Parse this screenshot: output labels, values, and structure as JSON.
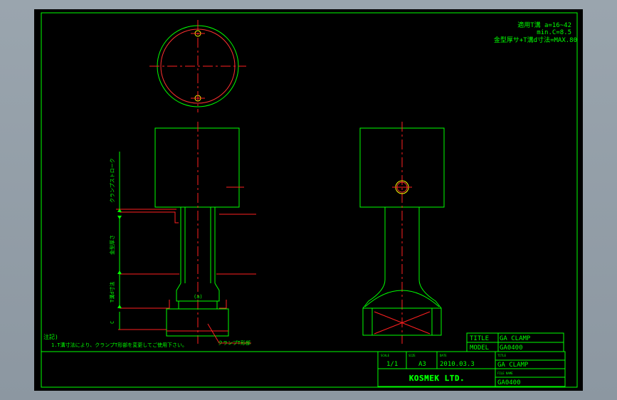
{
  "notes_block": {
    "line1": "適用T溝 a=16~42",
    "line2": "min.C=8.5",
    "line3": "金型厚サ+T溝d寸法=MAX.80"
  },
  "dimensions": {
    "stroke": "クランプストローク",
    "mold": "金型厚さ",
    "tslot": "T溝d寸法",
    "c": "C",
    "a_label": "(a)"
  },
  "leader_label": "クランプT形部",
  "remarks": {
    "title": "注記)",
    "line1": "1.T溝寸法により、クランプT形部を変更してご使用下さい。"
  },
  "title_block": {
    "title_label": "TITLE",
    "title_value": "GA CLAMP",
    "model_label": "MODEL",
    "model_value": "GA0400",
    "scale_label": "SCALE",
    "scale_value": "1/1",
    "size_label": "SIZE",
    "size_value": "A3",
    "date_label": "DATE",
    "date_value": "2010.03.3",
    "title2_label": "TITLE",
    "title2_value": "GA CLAMP",
    "company": "KOSMEK LTD.",
    "filename_label": "FILE NAME",
    "filename_value": "GA0400"
  },
  "colors": {
    "geometry": "#00ff00",
    "centerline": "#ff2020",
    "dimension": "#00ff00",
    "text": "#00ff00",
    "highlight": "#ffff00"
  }
}
